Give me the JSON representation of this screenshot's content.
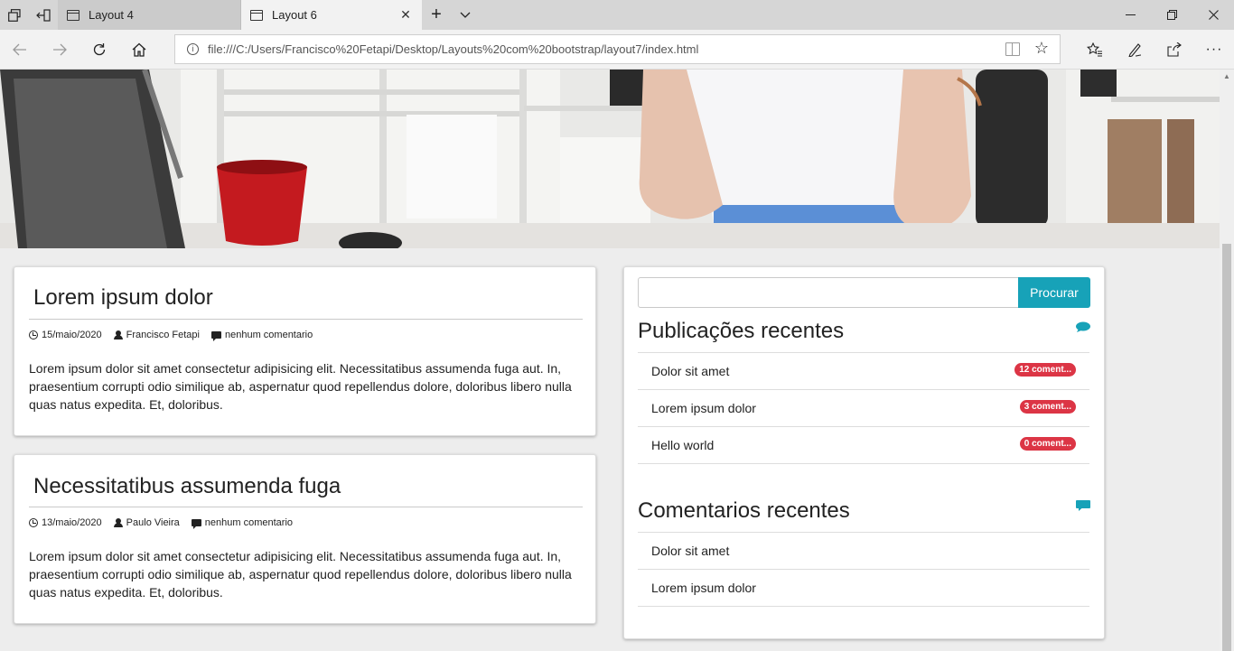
{
  "browser": {
    "tabs": [
      {
        "label": "Layout 4"
      },
      {
        "label": "Layout 6"
      }
    ],
    "url": "file:///C:/Users/Francisco%20Fetapi/Desktop/Layouts%20com%20bootstrap/layout7/index.html"
  },
  "posts": [
    {
      "title": "Lorem ipsum dolor",
      "date": "15/maio/2020",
      "author": "Francisco Fetapi",
      "comments": "nenhum comentario",
      "body": "Lorem ipsum dolor sit amet consectetur adipisicing elit. Necessitatibus assumenda fuga aut. In, praesentium corrupti odio similique ab, aspernatur quod repellendus dolore, doloribus libero nulla quas natus expedita. Et, doloribus."
    },
    {
      "title": "Necessitatibus assumenda fuga",
      "date": "13/maio/2020",
      "author": "Paulo Vieira",
      "comments": "nenhum comentario",
      "body": "Lorem ipsum dolor sit amet consectetur adipisicing elit. Necessitatibus assumenda fuga aut. In, praesentium corrupti odio similique ab, aspernatur quod repellendus dolore, doloribus libero nulla quas natus expedita. Et, doloribus."
    }
  ],
  "sidebar": {
    "search_button": "Procurar",
    "search_value": "",
    "recent_posts_title": "Publicações recentes",
    "recent_posts": [
      {
        "label": "Dolor sit amet",
        "badge": "12 coment..."
      },
      {
        "label": "Lorem ipsum dolor",
        "badge": "3 coment..."
      },
      {
        "label": "Hello world",
        "badge": "0 coment..."
      }
    ],
    "recent_comments_title": "Comentarios recentes",
    "recent_comments": [
      {
        "label": "Dolor sit amet"
      },
      {
        "label": "Lorem ipsum dolor"
      }
    ]
  },
  "colors": {
    "accent": "#17a2b8",
    "badge": "#dc3545"
  }
}
